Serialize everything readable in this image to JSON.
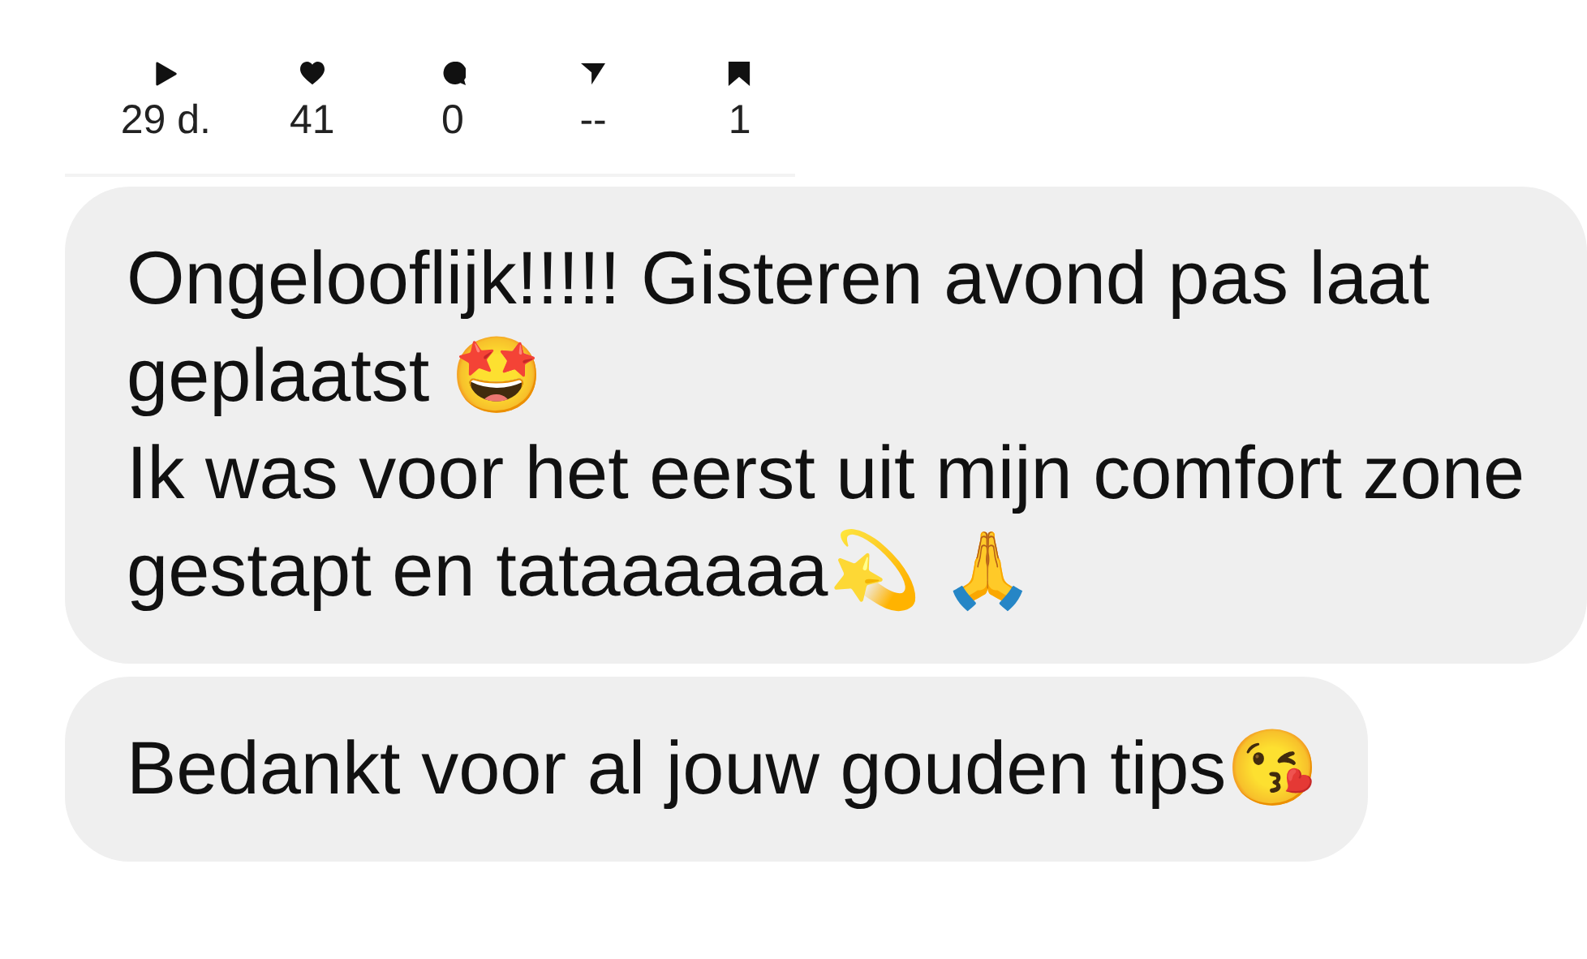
{
  "stats": [
    {
      "kind": "plays",
      "value": "29 d."
    },
    {
      "kind": "likes",
      "value": "41"
    },
    {
      "kind": "comments",
      "value": "0"
    },
    {
      "kind": "shares",
      "value": "--"
    },
    {
      "kind": "saves",
      "value": "1"
    }
  ],
  "messages": [
    {
      "text": "Ongelooflijk!!!!! Gisteren avond pas laat geplaatst 🤩\nIk was voor het eerst uit mijn comfort zone gestapt en tataaaaaa💫 🙏"
    },
    {
      "text": "Bedankt voor al jouw gouden tips😘"
    }
  ]
}
